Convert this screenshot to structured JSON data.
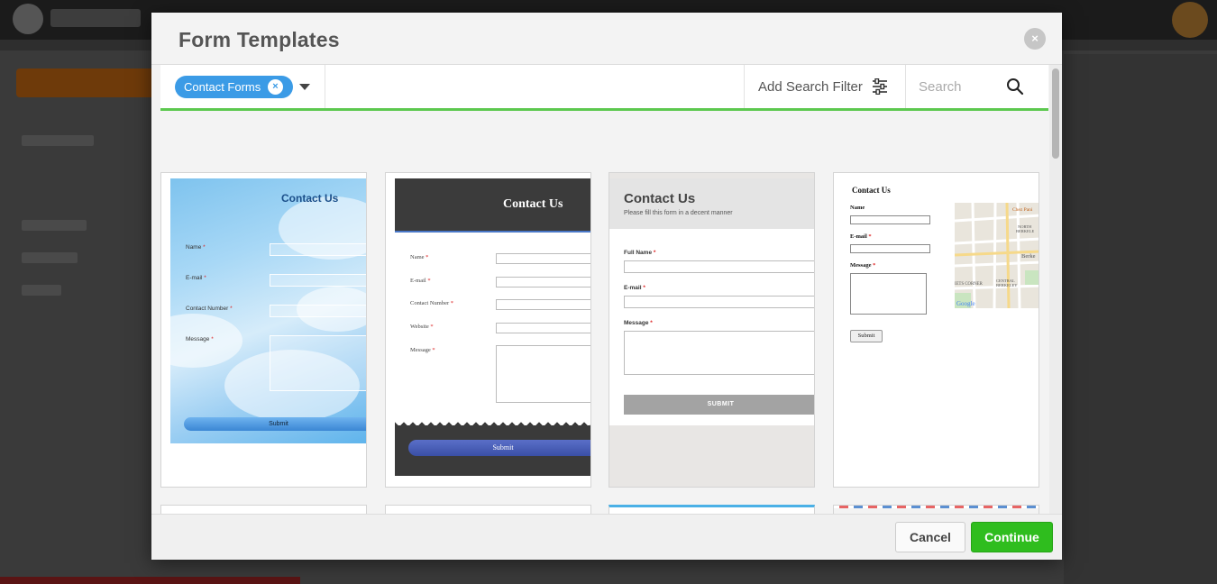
{
  "modal": {
    "title": "Form Templates",
    "close_label": "×"
  },
  "filter": {
    "chip_label": "Contact Forms",
    "chip_remove": "×",
    "add_filter_label": "Add Search Filter",
    "search_placeholder": "Search"
  },
  "templates": [
    {
      "title": "Contact Us",
      "fields": [
        "Name",
        "E-mail",
        "Contact Number",
        "Message"
      ],
      "submit": "Submit"
    },
    {
      "title": "Contact Us",
      "fields": [
        "Name",
        "E-mail",
        "Contact Number",
        "Website",
        "Message"
      ],
      "submit": "Submit"
    },
    {
      "title": "Contact Us",
      "subtitle": "Please fill this form in a decent manner",
      "fields": [
        "Full Name",
        "E-mail",
        "Message"
      ],
      "submit": "SUBMIT"
    },
    {
      "title": "Contact Us",
      "fields": [
        "Name",
        "E-mail",
        "Message"
      ],
      "submit": "Submit",
      "map_labels": [
        "Chez Pani",
        "NORTH",
        "BERKELE",
        "Berke",
        "IETS CORNER",
        "CENTRAL",
        "BERKELEY",
        "Google"
      ]
    }
  ],
  "required_mark": "*",
  "footer": {
    "cancel_label": "Cancel",
    "continue_label": "Continue"
  },
  "colors": {
    "accent_green": "#2fbd1e",
    "chip_blue": "#3b9be6",
    "filter_underline": "#5cc84f"
  }
}
